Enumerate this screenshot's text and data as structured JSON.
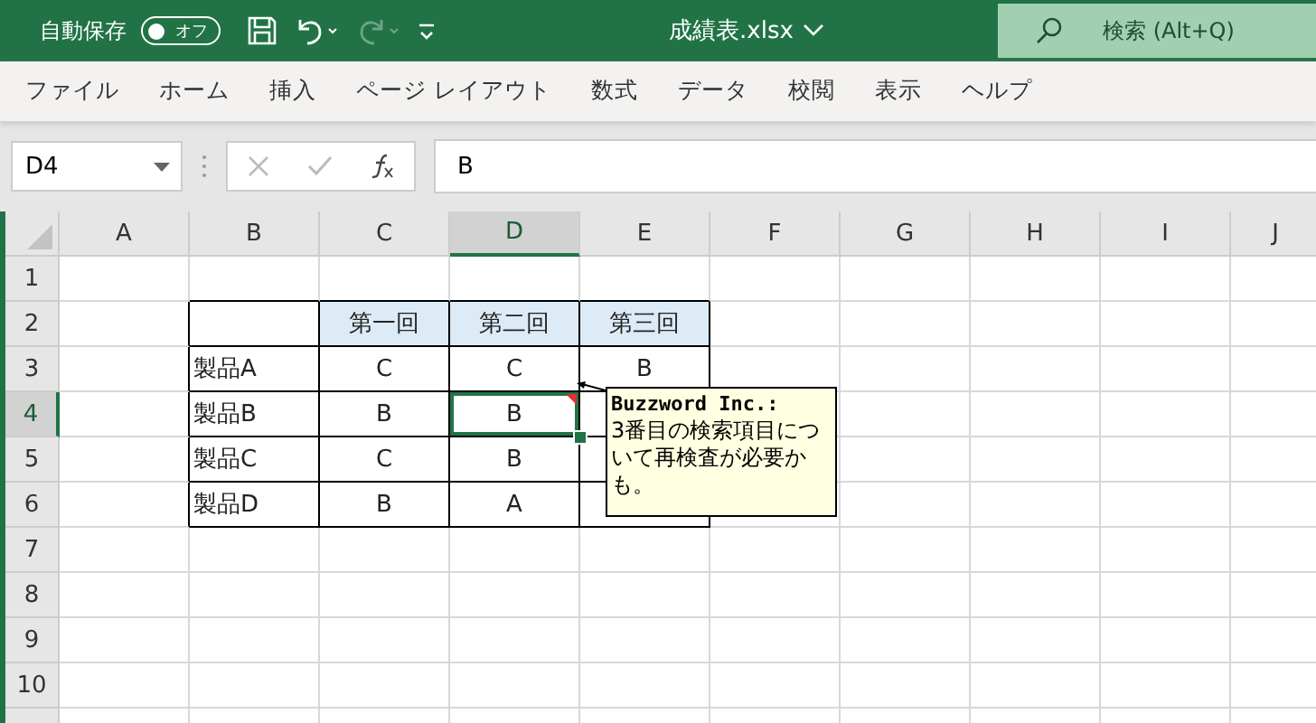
{
  "title_bar": {
    "autosave_label": "自動保存",
    "autosave_toggle": {
      "text": "オフ",
      "on": false
    },
    "redo_disabled": true,
    "file_name": "成績表.xlsx",
    "search": {
      "placeholder": "検索 (Alt+Q)"
    }
  },
  "ribbon_tabs": [
    {
      "label": "ファイル"
    },
    {
      "label": "ホーム"
    },
    {
      "label": "挿入"
    },
    {
      "label": "ページ レイアウト"
    },
    {
      "label": "数式"
    },
    {
      "label": "データ"
    },
    {
      "label": "校閲"
    },
    {
      "label": "表示"
    },
    {
      "label": "ヘルプ"
    }
  ],
  "formula_bar": {
    "name_box": "D4",
    "value": "B"
  },
  "columns": [
    {
      "label": "A",
      "selected": false
    },
    {
      "label": "B",
      "selected": false
    },
    {
      "label": "C",
      "selected": false
    },
    {
      "label": "D",
      "selected": true
    },
    {
      "label": "E",
      "selected": false
    },
    {
      "label": "F",
      "selected": false
    },
    {
      "label": "G",
      "selected": false
    },
    {
      "label": "H",
      "selected": false
    },
    {
      "label": "I",
      "selected": false
    },
    {
      "label": "J",
      "selected": false
    }
  ],
  "rows": [
    {
      "label": "1",
      "selected": false
    },
    {
      "label": "2",
      "selected": false
    },
    {
      "label": "3",
      "selected": false
    },
    {
      "label": "4",
      "selected": true
    },
    {
      "label": "5",
      "selected": false
    },
    {
      "label": "6",
      "selected": false
    },
    {
      "label": "7",
      "selected": false
    },
    {
      "label": "8",
      "selected": false
    },
    {
      "label": "9",
      "selected": false
    },
    {
      "label": "10",
      "selected": false
    }
  ],
  "table": {
    "headers": [
      "第一回",
      "第二回",
      "第三回"
    ],
    "rows": [
      {
        "label": "製品A",
        "values": [
          "C",
          "C",
          "B"
        ]
      },
      {
        "label": "製品B",
        "values": [
          "B",
          "B"
        ]
      },
      {
        "label": "製品C",
        "values": [
          "C",
          "B"
        ]
      },
      {
        "label": "製品D",
        "values": [
          "B",
          "A"
        ]
      }
    ]
  },
  "comment": {
    "author": "Buzzword Inc.:",
    "text": "3番目の検索項目について再検査が必要かも。"
  }
}
